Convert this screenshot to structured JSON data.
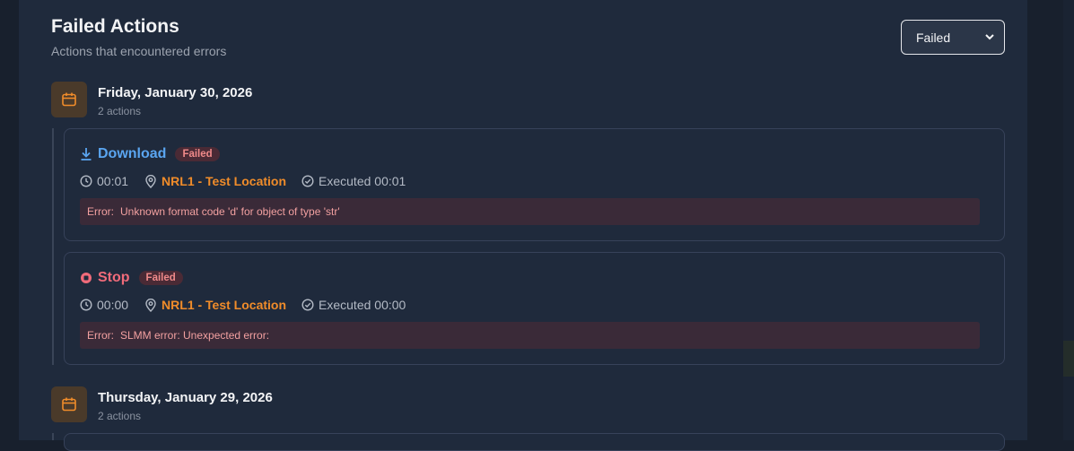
{
  "header": {
    "title": "Failed Actions",
    "subtitle": "Actions that encountered errors"
  },
  "filter": {
    "selected": "Failed"
  },
  "groups": [
    {
      "date": "Friday, January 30, 2026",
      "count": "2 actions",
      "actions": [
        {
          "name": "Download",
          "icon": "download-icon",
          "color": "#5aa5f0",
          "status": "Failed",
          "time": "00:01",
          "location": "NRL1 - Test Location",
          "executed": "Executed 00:01",
          "error_label": "Error:",
          "error_message": "Unknown format code 'd' for object of type 'str'"
        },
        {
          "name": "Stop",
          "icon": "stop-icon",
          "color": "#f06b7a",
          "status": "Failed",
          "time": "00:00",
          "location": "NRL1 - Test Location",
          "executed": "Executed 00:00",
          "error_label": "Error:",
          "error_message": "SLMM error: Unexpected error:"
        }
      ]
    },
    {
      "date": "Thursday, January 29, 2026",
      "count": "2 actions"
    }
  ],
  "colors": {
    "accent_orange": "#f08c2a",
    "error_text": "#f2a0a0",
    "download_blue": "#5aa5f0",
    "stop_red": "#f06b7a"
  }
}
